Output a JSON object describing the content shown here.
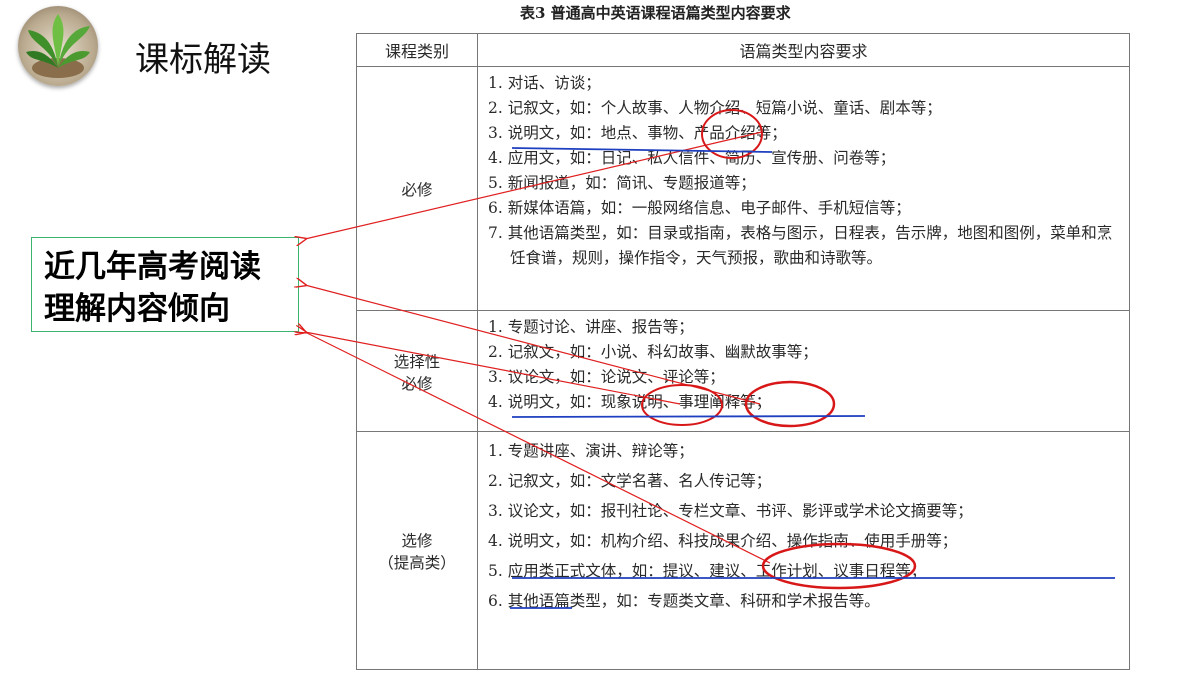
{
  "slide": {
    "title": "课标解读",
    "callout_lines": [
      "近几年高考阅读",
      "理解内容倾向"
    ]
  },
  "table": {
    "caption": "表3 普通高中英语课程语篇类型内容要求",
    "headers": [
      "课程类别",
      "语篇类型内容要求"
    ],
    "rows": [
      {
        "category": "必修",
        "items": [
          "1. 对话、访谈；",
          "2. 记叙文，如：个人故事、人物介绍、短篇小说、童话、剧本等；",
          "3. 说明文，如：地点、事物、产品介绍等；",
          "4. 应用文，如：日记、私人信件、简历、宣传册、问卷等；",
          "5. 新闻报道，如：简讯、专题报道等；",
          "6. 新媒体语篇，如：一般网络信息、电子邮件、手机短信等；",
          "7. 其他语篇类型，如：目录或指南，表格与图示，日程表，告示牌，地图和图例，菜单和烹饪食谱，规则，操作指令，天气预报，歌曲和诗歌等。"
        ]
      },
      {
        "category_lines": [
          "选择性",
          "必修"
        ],
        "items": [
          "1. 专题讨论、讲座、报告等；",
          "2. 记叙文，如：小说、科幻故事、幽默故事等；",
          "3. 议论文，如：论说文、评论等；",
          "4. 说明文，如：现象说明、事理阐释等；"
        ]
      },
      {
        "category_lines": [
          "选修",
          "（提高类）"
        ],
        "items": [
          "1. 专题讲座、演讲、辩论等；",
          "2. 记叙文，如：文学名著、名人传记等；",
          "3. 议论文，如：报刊社论、专栏文章、书评、影评或学术论文摘要等；",
          "4. 说明文，如：机构介绍、科技成果介绍、操作指南、使用手册等；",
          "5. 应用类正式文体，如：提议、建议、工作计划、议事日程等；",
          "6. 其他语篇类型，如：专题类文章、科研和学术报告等。"
        ]
      }
    ]
  },
  "colors": {
    "arrow": "#e02020",
    "circle": "#d81818",
    "underline": "#1e3fbf",
    "callout_border": "#3cb371"
  },
  "icons": [
    "plant-logo-icon"
  ]
}
